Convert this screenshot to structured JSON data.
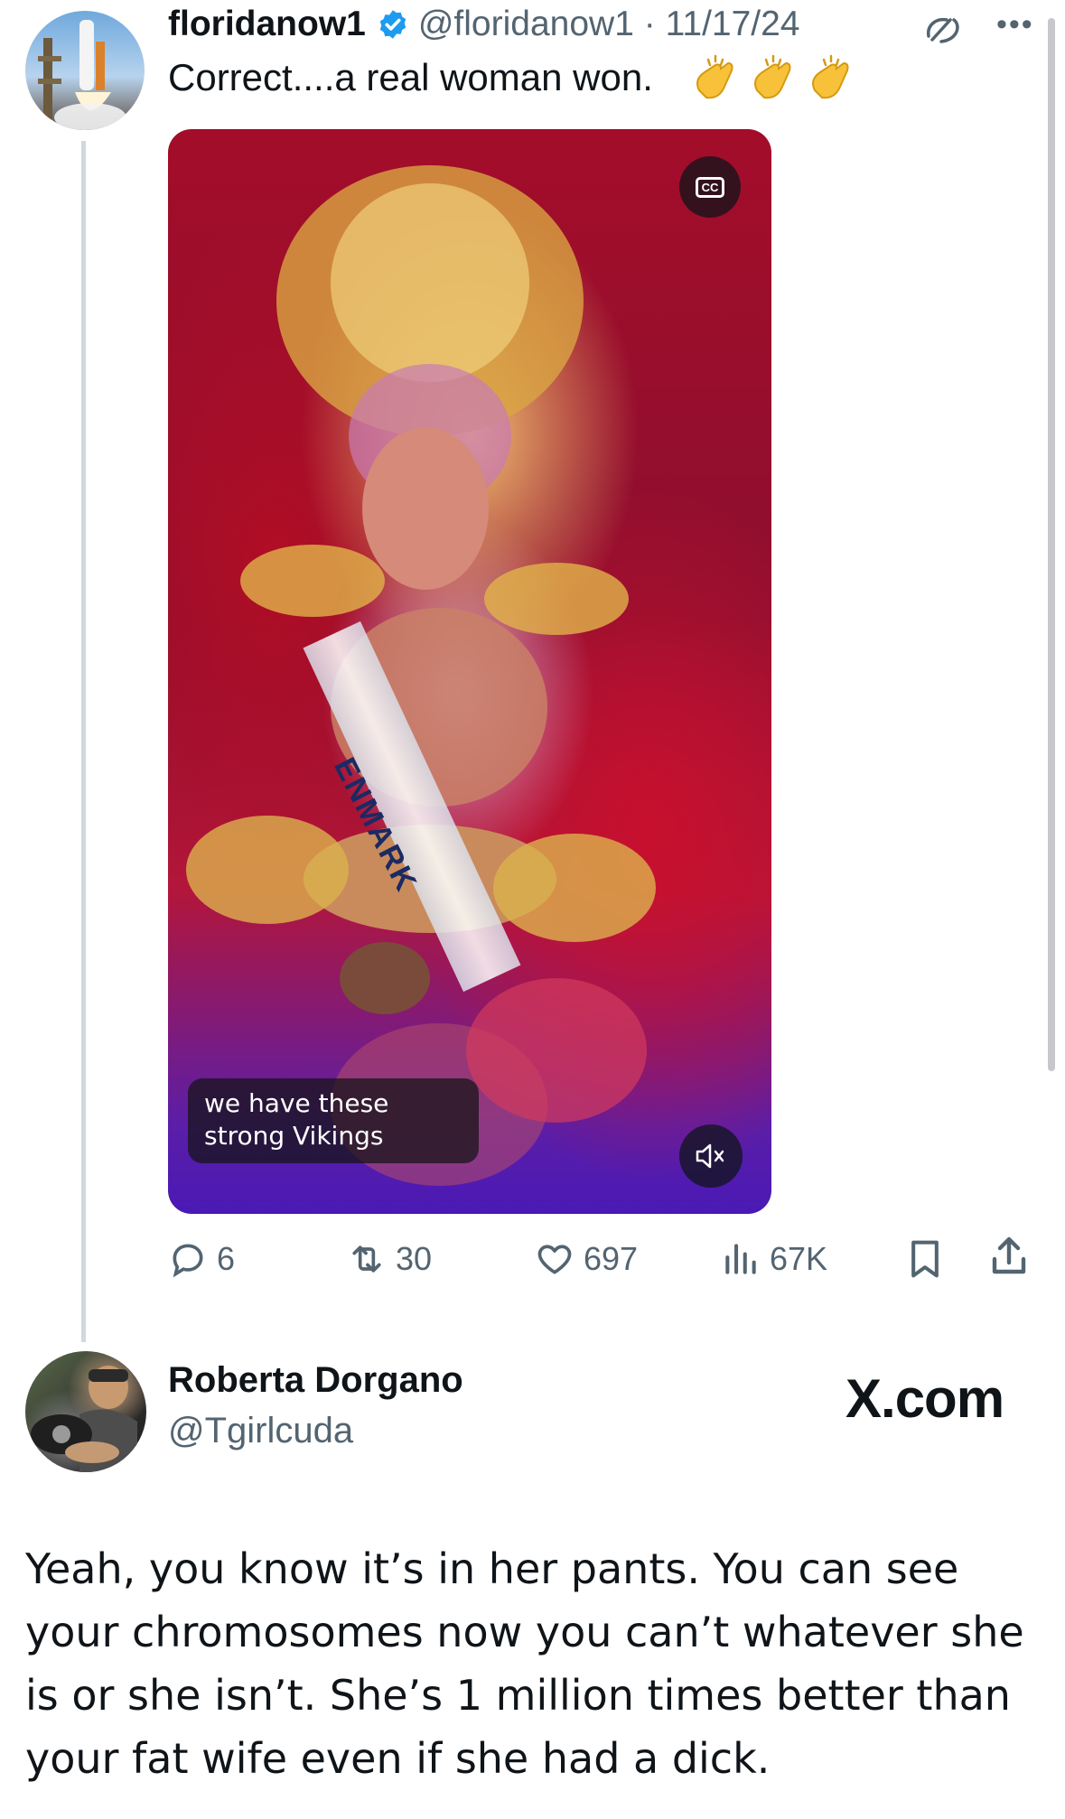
{
  "tweet1": {
    "display_name": "floridanow1",
    "handle": "@floridanow1",
    "separator": "·",
    "date": "11/17/24",
    "text": "Correct....a real woman won.",
    "emoji": [
      "clapping-hands",
      "clapping-hands",
      "clapping-hands"
    ],
    "video": {
      "cc_label": "CC",
      "caption": "we have these strong Vikings",
      "sash_text": "ENMARK"
    },
    "actions": {
      "replies": "6",
      "retweets": "30",
      "likes": "697",
      "views": "67K"
    }
  },
  "tweet2": {
    "display_name": "Roberta Dorgano",
    "handle": "@Tgirlcuda",
    "text": "Yeah, you know it’s in her pants. You can see your chromosomes now you can’t whatever she is or she isn’t. She’s 1 million times better than your fat wife even if she had a dick."
  },
  "watermark": "X.com",
  "colors": {
    "verified_blue": "#1d9bf0",
    "secondary_text": "#536471",
    "thread_line": "#cfd9de"
  }
}
